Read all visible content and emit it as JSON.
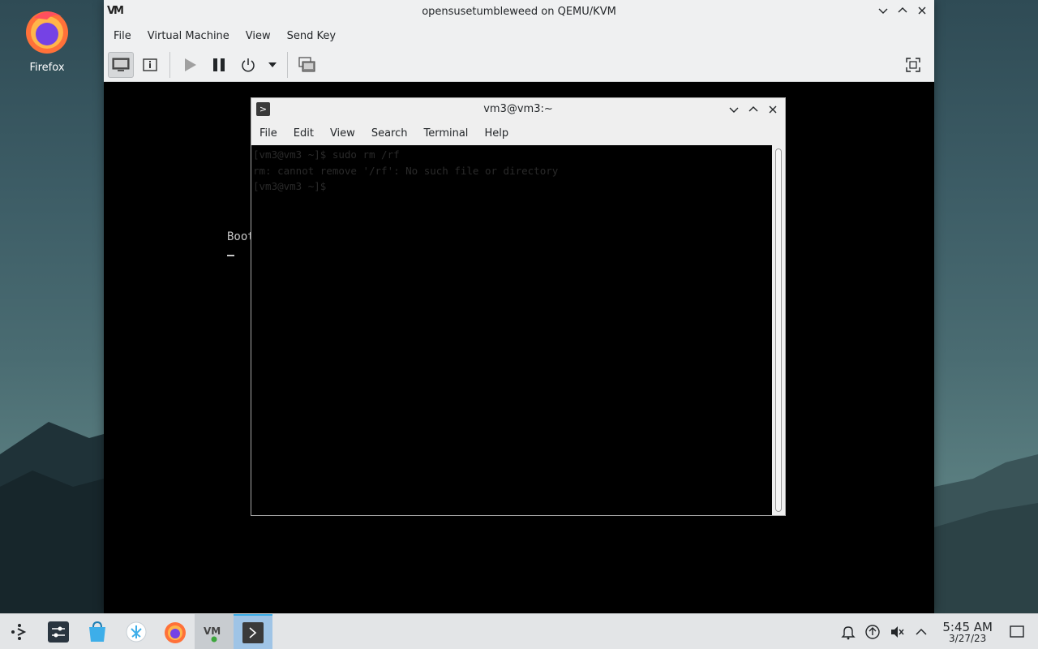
{
  "desktop": {
    "icons": [
      {
        "label": "Firefox",
        "icon": "firefox-icon"
      }
    ]
  },
  "vm_window": {
    "title": "opensusetumbleweed on QEMU/KVM",
    "logo": "VM",
    "menu": [
      "File",
      "Virtual Machine",
      "View",
      "Send Key"
    ],
    "toolbar": [
      "console-icon",
      "details-icon",
      "run-icon",
      "pause-icon",
      "shutdown-icon",
      "dropdown-icon",
      "snapshots-icon",
      "fullscreen-icon"
    ],
    "screen_text": "Boot"
  },
  "terminal": {
    "title": "vm3@vm3:~",
    "menu": [
      "File",
      "Edit",
      "View",
      "Search",
      "Terminal",
      "Help"
    ],
    "lines": [
      "[vm3@vm3 ~]$ sudo rm /rf",
      "rm: cannot remove '/rf': No such file or directory",
      "[vm3@vm3 ~]$ "
    ]
  },
  "taskbar": {
    "items": [
      "launcher-icon",
      "settings-icon",
      "discover-store-icon",
      "kde-connect-icon",
      "firefox-icon",
      "virt-manager-icon",
      "terminal-icon"
    ],
    "tray": [
      "notification-icon",
      "update-icon",
      "volume-muted-icon",
      "expand-tray-icon"
    ],
    "time": "5:45 AM",
    "date": "3/27/23"
  },
  "colors": {
    "accent": "#3daee9",
    "terminal_bg": "#000000",
    "panel_bg": "#e3e5e7"
  }
}
